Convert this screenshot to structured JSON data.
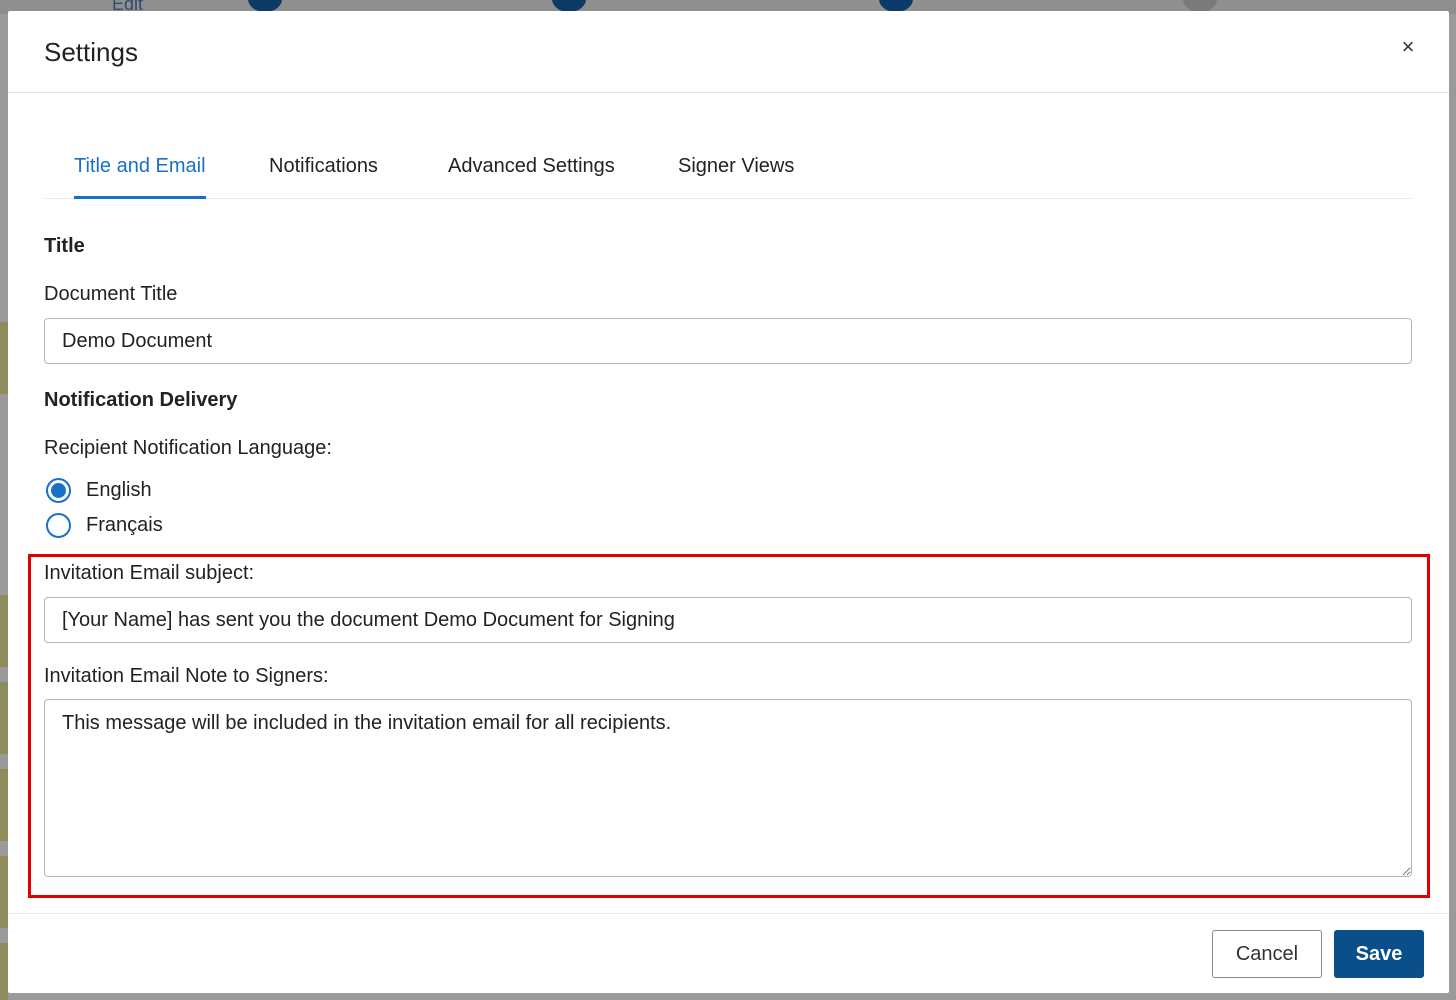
{
  "background": {
    "edit_label": "Edit",
    "step_colors": [
      "#0b3a66",
      "#0b3a66",
      "#0b3a66",
      "#7a7a7a"
    ]
  },
  "modal": {
    "title": "Settings",
    "close_glyph": "×",
    "tabs": [
      {
        "label": "Title and Email",
        "active": true
      },
      {
        "label": "Notifications",
        "active": false
      },
      {
        "label": "Advanced Settings",
        "active": false
      },
      {
        "label": "Signer Views",
        "active": false
      }
    ],
    "title_section": {
      "heading": "Title",
      "document_title_label": "Document Title",
      "document_title_value": "Demo Document"
    },
    "notification_delivery": {
      "heading": "Notification Delivery",
      "language_label": "Recipient Notification Language:",
      "languages": [
        {
          "label": "English",
          "selected": true
        },
        {
          "label": "Français",
          "selected": false
        }
      ],
      "subject_label": "Invitation Email subject:",
      "subject_value": "[Your Name] has sent you the document Demo Document for Signing",
      "note_label": "Invitation Email Note to Signers:",
      "note_value": "This message will be included in the invitation email for all recipients."
    },
    "footer": {
      "cancel_label": "Cancel",
      "save_label": "Save"
    }
  },
  "colors": {
    "accent": "#1a6fc9",
    "primary_button": "#0b4f8a",
    "highlight": "#e00000"
  }
}
